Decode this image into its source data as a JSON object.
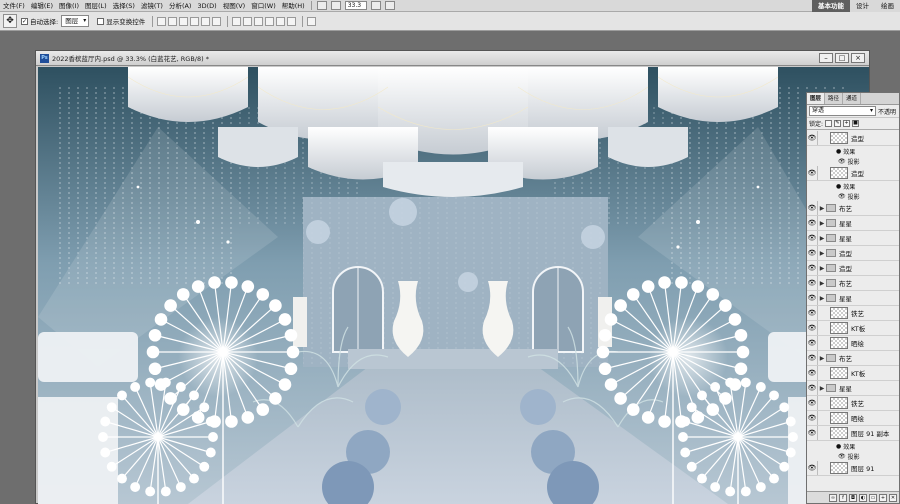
{
  "menubar": {
    "items": [
      "文件(F)",
      "编辑(E)",
      "图像(I)",
      "图层(L)",
      "选择(S)",
      "滤镜(T)",
      "分析(A)",
      "3D(D)",
      "视图(V)",
      "窗口(W)",
      "帮助(H)"
    ],
    "zoom": "33.3",
    "workspaces": [
      {
        "label": "基本功能",
        "active": true
      },
      {
        "label": "设计",
        "active": false
      },
      {
        "label": "绘画",
        "active": false
      }
    ]
  },
  "options": {
    "auto_select_label": "自动选择:",
    "auto_select_value": "图层",
    "show_transform_label": "显示变换控件"
  },
  "document": {
    "title": "2022香槟蓝厅内.psd @ 33.3% (白蓝花艺, RGB/8) *",
    "ps_badge": "Ps"
  },
  "layers_panel": {
    "tabs": [
      {
        "label": "图层",
        "active": true
      },
      {
        "label": "路径",
        "active": false
      },
      {
        "label": "通道",
        "active": false
      }
    ],
    "blend_mode": "穿透",
    "opacity_label": "不透明",
    "lock_label": "锁定:",
    "layers": [
      {
        "kind": "layer",
        "name": "造型",
        "eye": true
      },
      {
        "kind": "fx",
        "name": "效果"
      },
      {
        "kind": "effect",
        "name": "投影"
      },
      {
        "kind": "layer",
        "name": "造型",
        "eye": true
      },
      {
        "kind": "fx",
        "name": "效果"
      },
      {
        "kind": "effect",
        "name": "投影"
      },
      {
        "kind": "group",
        "name": "布艺",
        "eye": true
      },
      {
        "kind": "group",
        "name": "星星",
        "eye": true
      },
      {
        "kind": "group",
        "name": "星星",
        "eye": true
      },
      {
        "kind": "group",
        "name": "造型",
        "eye": true
      },
      {
        "kind": "group",
        "name": "造型",
        "eye": true
      },
      {
        "kind": "group",
        "name": "布艺",
        "eye": true
      },
      {
        "kind": "group",
        "name": "星星",
        "eye": true
      },
      {
        "kind": "layer",
        "name": "铁艺",
        "eye": true
      },
      {
        "kind": "layer",
        "name": "KT板",
        "eye": true
      },
      {
        "kind": "layer",
        "name": "晒绘",
        "eye": true
      },
      {
        "kind": "group",
        "name": "布艺",
        "eye": true
      },
      {
        "kind": "layer",
        "name": "KT板",
        "eye": true
      },
      {
        "kind": "group",
        "name": "星星",
        "eye": true
      },
      {
        "kind": "layer",
        "name": "铁艺",
        "eye": true
      },
      {
        "kind": "layer",
        "name": "晒绘",
        "eye": true
      },
      {
        "kind": "layer",
        "name": "图层 91 副本",
        "eye": true
      },
      {
        "kind": "fx",
        "name": "效果"
      },
      {
        "kind": "effect",
        "name": "投影"
      },
      {
        "kind": "layer",
        "name": "图层 91",
        "eye": true
      }
    ]
  },
  "colors": {
    "accent_active": "#5f5f5f",
    "canvas_blue": "#8fa6b6",
    "floor": "#c7d1de"
  }
}
